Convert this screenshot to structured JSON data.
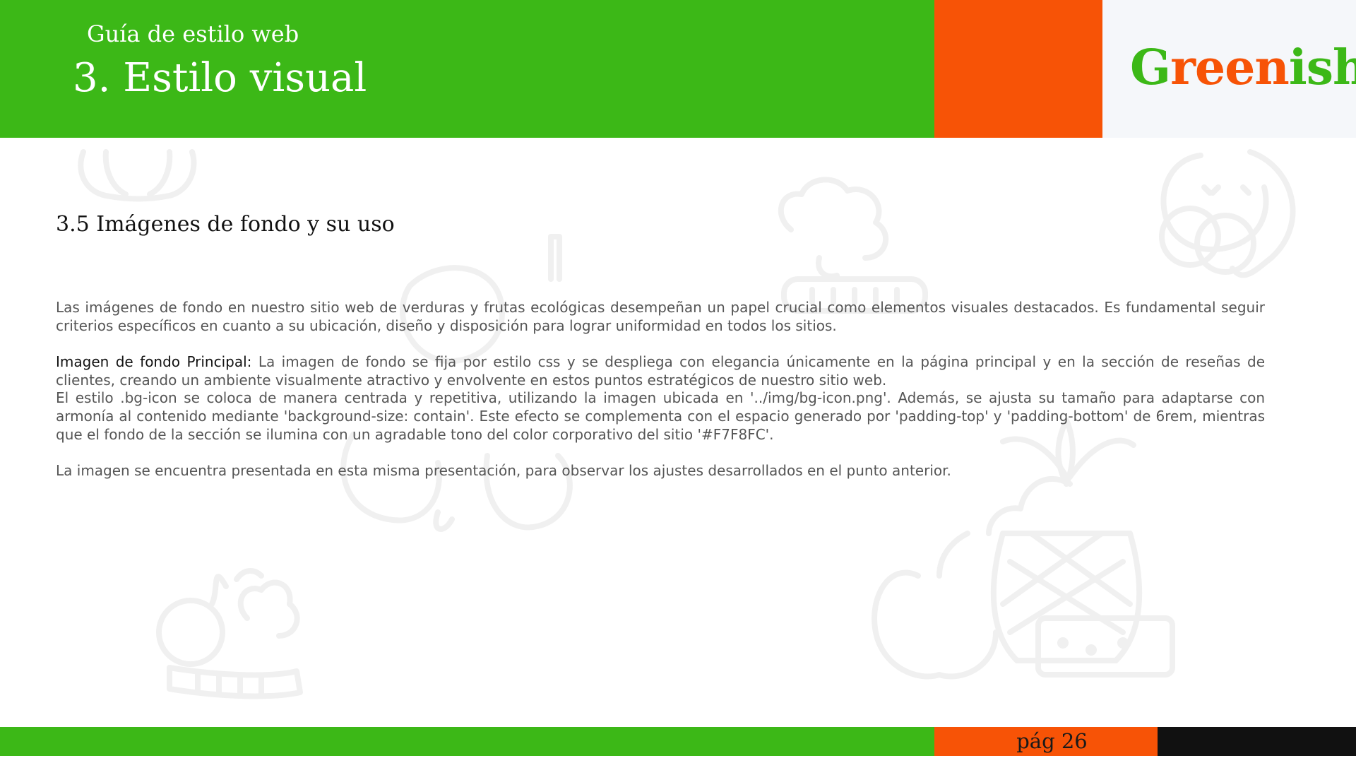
{
  "header": {
    "subtitle": "Guía de estilo web",
    "title": "3. Estilo visual",
    "logo": {
      "part1": "G",
      "part2": "reen",
      "part3": "ish"
    }
  },
  "section": {
    "title": "3.5 Imágenes de fondo y su uso",
    "paragraph1": "Las imágenes de fondo en nuestro sitio web de verduras y frutas ecológicas desempeñan un papel crucial como elementos visuales destacados. Es fundamental seguir criterios específicos en cuanto a su ubicación, diseño y disposición para lograr uniformidad en todos los sitios.",
    "paragraph2_lead": "Imagen de fondo Principal:",
    "paragraph2_body": " La imagen de fondo se fija por estilo css y se despliega con elegancia únicamente en la página principal y en la sección de reseñas de clientes, creando un ambiente visualmente atractivo y envolvente en estos puntos estratégicos de nuestro sitio web.",
    "paragraph3": "El estilo .bg-icon se coloca de manera centrada y repetitiva, utilizando la imagen ubicada en '../img/bg-icon.png'. Además, se ajusta su tamaño para adaptarse con armonía al contenido mediante 'background-size: contain'. Este efecto se complementa con el espacio generado por 'padding-top' y 'padding-bottom' de 6rem, mientras que el fondo de la sección se ilumina con un agradable tono del color corporativo del sitio '#F7F8FC'.",
    "paragraph4": "La imagen se encuentra presentada en esta misma presentación, para observar los ajustes desarrollados en el punto anterior."
  },
  "footer": {
    "page": "pág 26"
  },
  "colors": {
    "green": "#3cb817",
    "orange": "#f75306",
    "light": "#f5f7fa",
    "black": "#111111",
    "watermark": "#f0f0f0"
  },
  "icons": [
    "fruit-basket-icon",
    "broccoli-icon",
    "pineapple-icon",
    "watermelon-icon",
    "fruits-icon",
    "vegetables-icon"
  ]
}
